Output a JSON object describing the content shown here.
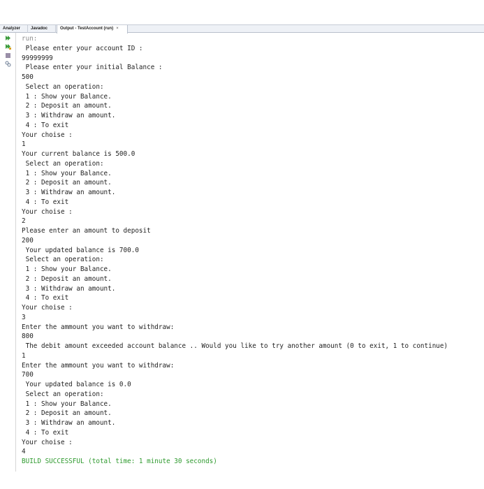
{
  "tabs": [
    {
      "label": "Analyzer",
      "active": false
    },
    {
      "label": "Javadoc",
      "active": false
    },
    {
      "label": "Output - TestAccount (run)",
      "active": true,
      "close": "×"
    }
  ],
  "tools": [
    "rerun-icon",
    "rerun-with-options-icon",
    "stop-icon",
    "settings-icon"
  ],
  "colors": {
    "success": "#2e9a2e",
    "run_header": "#8c8c8c",
    "text": "#222222"
  },
  "output": {
    "lines": [
      {
        "text": "run:",
        "kind": "run"
      },
      {
        "text": " Please enter your account ID :",
        "kind": "text"
      },
      {
        "text": "99999999",
        "kind": "text"
      },
      {
        "text": " Please enter your initial Balance :",
        "kind": "text"
      },
      {
        "text": "500",
        "kind": "text"
      },
      {
        "text": " Select an operation:",
        "kind": "text"
      },
      {
        "text": " 1 : Show your Balance.",
        "kind": "text"
      },
      {
        "text": " 2 : Deposit an amount.",
        "kind": "text"
      },
      {
        "text": " 3 : Withdraw an amount.",
        "kind": "text"
      },
      {
        "text": " 4 : To exit",
        "kind": "text"
      },
      {
        "text": "Your choise :",
        "kind": "text"
      },
      {
        "text": "1",
        "kind": "text"
      },
      {
        "text": "Your current balance is 500.0",
        "kind": "text"
      },
      {
        "text": " Select an operation:",
        "kind": "text"
      },
      {
        "text": " 1 : Show your Balance.",
        "kind": "text"
      },
      {
        "text": " 2 : Deposit an amount.",
        "kind": "text"
      },
      {
        "text": " 3 : Withdraw an amount.",
        "kind": "text"
      },
      {
        "text": " 4 : To exit",
        "kind": "text"
      },
      {
        "text": "Your choise :",
        "kind": "text"
      },
      {
        "text": "2",
        "kind": "text"
      },
      {
        "text": "Please enter an amount to deposit",
        "kind": "text"
      },
      {
        "text": "200",
        "kind": "text"
      },
      {
        "text": " Your updated balance is 700.0",
        "kind": "text"
      },
      {
        "text": " Select an operation:",
        "kind": "text"
      },
      {
        "text": " 1 : Show your Balance.",
        "kind": "text"
      },
      {
        "text": " 2 : Deposit an amount.",
        "kind": "text"
      },
      {
        "text": " 3 : Withdraw an amount.",
        "kind": "text"
      },
      {
        "text": " 4 : To exit",
        "kind": "text"
      },
      {
        "text": "Your choise :",
        "kind": "text"
      },
      {
        "text": "3",
        "kind": "text"
      },
      {
        "text": "Enter the ammount you want to withdraw:",
        "kind": "text"
      },
      {
        "text": "800",
        "kind": "text"
      },
      {
        "text": " The debit amount exceeded account balance .. Would you like to try another amount (0 to exit, 1 to continue)",
        "kind": "text"
      },
      {
        "text": "1",
        "kind": "text"
      },
      {
        "text": "Enter the ammount you want to withdraw:",
        "kind": "text"
      },
      {
        "text": "700",
        "kind": "text"
      },
      {
        "text": " Your updated balance is 0.0",
        "kind": "text"
      },
      {
        "text": " Select an operation:",
        "kind": "text"
      },
      {
        "text": " 1 : Show your Balance.",
        "kind": "text"
      },
      {
        "text": " 2 : Deposit an amount.",
        "kind": "text"
      },
      {
        "text": " 3 : Withdraw an amount.",
        "kind": "text"
      },
      {
        "text": " 4 : To exit",
        "kind": "text"
      },
      {
        "text": "Your choise :",
        "kind": "text"
      },
      {
        "text": "4",
        "kind": "text"
      },
      {
        "text": "BUILD SUCCESSFUL (total time: 1 minute 30 seconds)",
        "kind": "success"
      }
    ]
  }
}
